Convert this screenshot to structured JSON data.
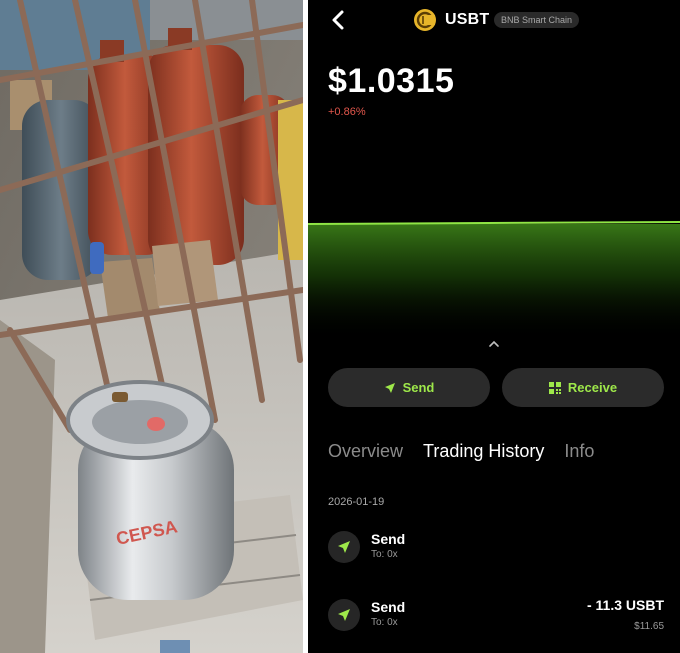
{
  "header": {
    "token_symbol": "USBT",
    "chain_badge": "BNB Smart Chain",
    "logo_letter": "C"
  },
  "price": {
    "value": "$1.0315",
    "change": "+0.86%"
  },
  "actions": {
    "send_label": "Send",
    "receive_label": "Receive"
  },
  "tabs": [
    {
      "label": "Overview",
      "active": false
    },
    {
      "label": "Trading History",
      "active": true
    },
    {
      "label": "Info",
      "active": false
    }
  ],
  "history": {
    "date": "2026-01-19",
    "transactions": [
      {
        "title": "Send",
        "to": "To: 0x",
        "amount": "",
        "fiat": ""
      },
      {
        "title": "Send",
        "to": "To: 0x",
        "amount": "- 11.3 USBT",
        "fiat": "$11.65"
      }
    ]
  },
  "photo": {
    "cylinder_brand": "CEPSA"
  },
  "colors": {
    "accent_green": "#9ee84a",
    "negative_red": "#e2574c",
    "background": "#000000",
    "button_bg": "#2b2b2b",
    "token_gold": "#e7b52a"
  }
}
